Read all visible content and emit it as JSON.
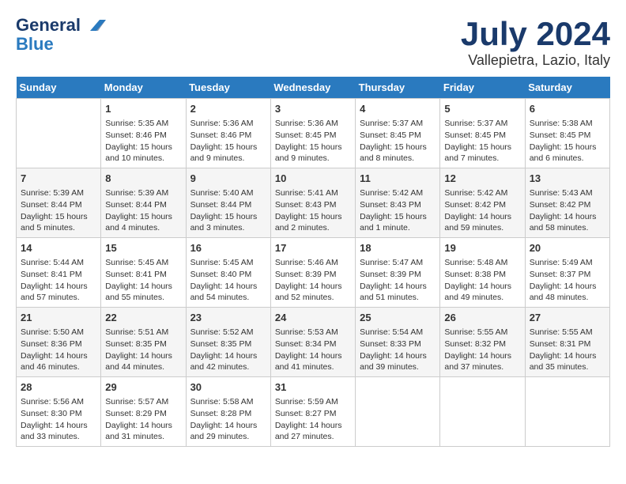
{
  "logo": {
    "general": "General",
    "blue": "Blue",
    "tagline": ""
  },
  "header": {
    "month_title": "July 2024",
    "location": "Vallepietra, Lazio, Italy"
  },
  "days_of_week": [
    "Sunday",
    "Monday",
    "Tuesday",
    "Wednesday",
    "Thursday",
    "Friday",
    "Saturday"
  ],
  "weeks": [
    [
      {
        "day": "",
        "info": ""
      },
      {
        "day": "1",
        "info": "Sunrise: 5:35 AM\nSunset: 8:46 PM\nDaylight: 15 hours\nand 10 minutes."
      },
      {
        "day": "2",
        "info": "Sunrise: 5:36 AM\nSunset: 8:46 PM\nDaylight: 15 hours\nand 9 minutes."
      },
      {
        "day": "3",
        "info": "Sunrise: 5:36 AM\nSunset: 8:45 PM\nDaylight: 15 hours\nand 9 minutes."
      },
      {
        "day": "4",
        "info": "Sunrise: 5:37 AM\nSunset: 8:45 PM\nDaylight: 15 hours\nand 8 minutes."
      },
      {
        "day": "5",
        "info": "Sunrise: 5:37 AM\nSunset: 8:45 PM\nDaylight: 15 hours\nand 7 minutes."
      },
      {
        "day": "6",
        "info": "Sunrise: 5:38 AM\nSunset: 8:45 PM\nDaylight: 15 hours\nand 6 minutes."
      }
    ],
    [
      {
        "day": "7",
        "info": "Sunrise: 5:39 AM\nSunset: 8:44 PM\nDaylight: 15 hours\nand 5 minutes."
      },
      {
        "day": "8",
        "info": "Sunrise: 5:39 AM\nSunset: 8:44 PM\nDaylight: 15 hours\nand 4 minutes."
      },
      {
        "day": "9",
        "info": "Sunrise: 5:40 AM\nSunset: 8:44 PM\nDaylight: 15 hours\nand 3 minutes."
      },
      {
        "day": "10",
        "info": "Sunrise: 5:41 AM\nSunset: 8:43 PM\nDaylight: 15 hours\nand 2 minutes."
      },
      {
        "day": "11",
        "info": "Sunrise: 5:42 AM\nSunset: 8:43 PM\nDaylight: 15 hours\nand 1 minute."
      },
      {
        "day": "12",
        "info": "Sunrise: 5:42 AM\nSunset: 8:42 PM\nDaylight: 14 hours\nand 59 minutes."
      },
      {
        "day": "13",
        "info": "Sunrise: 5:43 AM\nSunset: 8:42 PM\nDaylight: 14 hours\nand 58 minutes."
      }
    ],
    [
      {
        "day": "14",
        "info": "Sunrise: 5:44 AM\nSunset: 8:41 PM\nDaylight: 14 hours\nand 57 minutes."
      },
      {
        "day": "15",
        "info": "Sunrise: 5:45 AM\nSunset: 8:41 PM\nDaylight: 14 hours\nand 55 minutes."
      },
      {
        "day": "16",
        "info": "Sunrise: 5:45 AM\nSunset: 8:40 PM\nDaylight: 14 hours\nand 54 minutes."
      },
      {
        "day": "17",
        "info": "Sunrise: 5:46 AM\nSunset: 8:39 PM\nDaylight: 14 hours\nand 52 minutes."
      },
      {
        "day": "18",
        "info": "Sunrise: 5:47 AM\nSunset: 8:39 PM\nDaylight: 14 hours\nand 51 minutes."
      },
      {
        "day": "19",
        "info": "Sunrise: 5:48 AM\nSunset: 8:38 PM\nDaylight: 14 hours\nand 49 minutes."
      },
      {
        "day": "20",
        "info": "Sunrise: 5:49 AM\nSunset: 8:37 PM\nDaylight: 14 hours\nand 48 minutes."
      }
    ],
    [
      {
        "day": "21",
        "info": "Sunrise: 5:50 AM\nSunset: 8:36 PM\nDaylight: 14 hours\nand 46 minutes."
      },
      {
        "day": "22",
        "info": "Sunrise: 5:51 AM\nSunset: 8:35 PM\nDaylight: 14 hours\nand 44 minutes."
      },
      {
        "day": "23",
        "info": "Sunrise: 5:52 AM\nSunset: 8:35 PM\nDaylight: 14 hours\nand 42 minutes."
      },
      {
        "day": "24",
        "info": "Sunrise: 5:53 AM\nSunset: 8:34 PM\nDaylight: 14 hours\nand 41 minutes."
      },
      {
        "day": "25",
        "info": "Sunrise: 5:54 AM\nSunset: 8:33 PM\nDaylight: 14 hours\nand 39 minutes."
      },
      {
        "day": "26",
        "info": "Sunrise: 5:55 AM\nSunset: 8:32 PM\nDaylight: 14 hours\nand 37 minutes."
      },
      {
        "day": "27",
        "info": "Sunrise: 5:55 AM\nSunset: 8:31 PM\nDaylight: 14 hours\nand 35 minutes."
      }
    ],
    [
      {
        "day": "28",
        "info": "Sunrise: 5:56 AM\nSunset: 8:30 PM\nDaylight: 14 hours\nand 33 minutes."
      },
      {
        "day": "29",
        "info": "Sunrise: 5:57 AM\nSunset: 8:29 PM\nDaylight: 14 hours\nand 31 minutes."
      },
      {
        "day": "30",
        "info": "Sunrise: 5:58 AM\nSunset: 8:28 PM\nDaylight: 14 hours\nand 29 minutes."
      },
      {
        "day": "31",
        "info": "Sunrise: 5:59 AM\nSunset: 8:27 PM\nDaylight: 14 hours\nand 27 minutes."
      },
      {
        "day": "",
        "info": ""
      },
      {
        "day": "",
        "info": ""
      },
      {
        "day": "",
        "info": ""
      }
    ]
  ]
}
